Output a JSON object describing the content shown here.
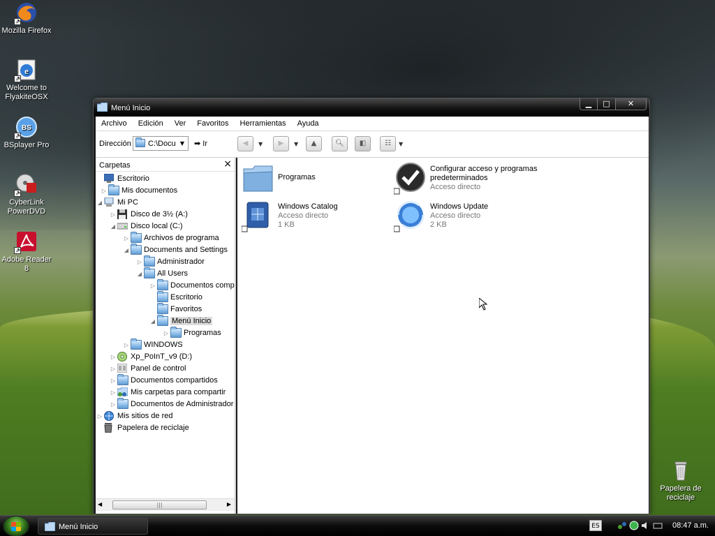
{
  "desktop": {
    "icons": [
      {
        "label": "Mozilla Firefox"
      },
      {
        "label": "Welcome to FlyakiteOSX"
      },
      {
        "label": "BSplayer Pro",
        "badge": "BS"
      },
      {
        "label": "CyberLink PowerDVD"
      },
      {
        "label": "Adobe Reader 8"
      },
      {
        "label": "Papelera de reciclaje"
      }
    ]
  },
  "window": {
    "title": "Menú Inicio",
    "menu": [
      "Archivo",
      "Edición",
      "Ver",
      "Favoritos",
      "Herramientas",
      "Ayuda"
    ],
    "address": {
      "label": "Dirección",
      "value": "C:\\Docu",
      "go": "Ir"
    },
    "tree_panel": {
      "title": "Carpetas",
      "nodes": [
        {
          "label": "Escritorio",
          "icon": "desktop-icon"
        },
        {
          "label": "Mis documentos",
          "icon": "folder-icon"
        },
        {
          "label": "Mi PC",
          "icon": "computer-icon"
        },
        {
          "label": "Disco de 3½ (A:)",
          "icon": "floppy-icon"
        },
        {
          "label": "Disco local (C:)",
          "icon": "drive-icon"
        },
        {
          "label": "Archivos de programa",
          "icon": "folder-icon"
        },
        {
          "label": "Documents and Settings",
          "icon": "folder-icon"
        },
        {
          "label": "Administrador",
          "icon": "folder-icon"
        },
        {
          "label": "All Users",
          "icon": "folder-icon"
        },
        {
          "label": "Documentos compa",
          "icon": "folder-icon"
        },
        {
          "label": "Escritorio",
          "icon": "folder-icon"
        },
        {
          "label": "Favoritos",
          "icon": "folder-icon"
        },
        {
          "label": "Menú Inicio",
          "icon": "folder-icon"
        },
        {
          "label": "Programas",
          "icon": "folder-icon"
        },
        {
          "label": "WINDOWS",
          "icon": "folder-icon"
        },
        {
          "label": "Xp_PoInT_v9 (D:)",
          "icon": "cd-icon"
        },
        {
          "label": "Panel de control",
          "icon": "control-panel-icon"
        },
        {
          "label": "Documentos compartidos",
          "icon": "folder-icon"
        },
        {
          "label": "Mis carpetas para compartir",
          "icon": "shared-folder-icon"
        },
        {
          "label": "Documentos de Administrador",
          "icon": "folder-icon"
        },
        {
          "label": "Mis sitios de red",
          "icon": "network-icon"
        },
        {
          "label": "Papelera de reciclaje",
          "icon": "recycle-bin-icon"
        }
      ]
    },
    "items": [
      {
        "name": "Programas",
        "type": "",
        "size": ""
      },
      {
        "name": "Configurar acceso y programas predeterminados",
        "type": "Acceso directo",
        "size": ""
      },
      {
        "name": "Windows Catalog",
        "type": "Acceso directo",
        "size": "1 KB"
      },
      {
        "name": "Windows Update",
        "type": "Acceso directo",
        "size": "2 KB"
      }
    ]
  },
  "taskbar": {
    "task_label": "Menú Inicio",
    "lang": "ES",
    "clock": "08:47 a.m."
  },
  "colors": {
    "folder_blue": "#8cbde9",
    "titlebar_black": "#141414"
  }
}
